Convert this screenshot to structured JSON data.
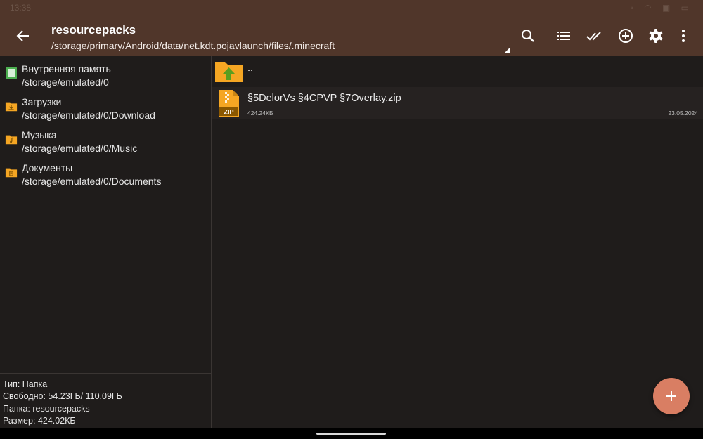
{
  "statusbar": {
    "time": "13:38"
  },
  "header": {
    "title": "resourcepacks",
    "path": "/storage/primary/Android/data/net.kdt.pojavlaunch/files/.minecraft",
    "background": "#50362a",
    "actions": [
      "search-icon",
      "list-view-icon",
      "select-all-icon",
      "add-circle-icon",
      "settings-icon",
      "more-vert-icon"
    ]
  },
  "drawer": {
    "storages": [
      {
        "name": "Внутренняя память",
        "path": "/storage/emulated/0",
        "icon": "internal-storage-icon"
      },
      {
        "name": "Загрузки",
        "path": "/storage/emulated/0/Download",
        "icon": "download-folder-icon"
      },
      {
        "name": "Музыка",
        "path": "/storage/emulated/0/Music",
        "icon": "music-folder-icon"
      },
      {
        "name": "Документы",
        "path": "/storage/emulated/0/Documents",
        "icon": "documents-folder-icon"
      }
    ],
    "info": {
      "type": "Тип: Папка",
      "free": "Свободно: 54.23ГБ/ 110.09ГБ",
      "folder": "Папка: resourcepacks",
      "size": "Размер: 424.02КБ"
    }
  },
  "files": {
    "parent": {
      "name": "..",
      "icon": "folder-up-icon"
    },
    "items": [
      {
        "name": "§5DelorVs §4CPVP §7Overlay.zip",
        "size": "424.24КБ",
        "date": "23.05.2024",
        "icon": "zip-file-icon"
      }
    ]
  },
  "colors": {
    "accent": "#d97e63",
    "folder": "#f5a623",
    "storage_green": "#4caf50"
  }
}
